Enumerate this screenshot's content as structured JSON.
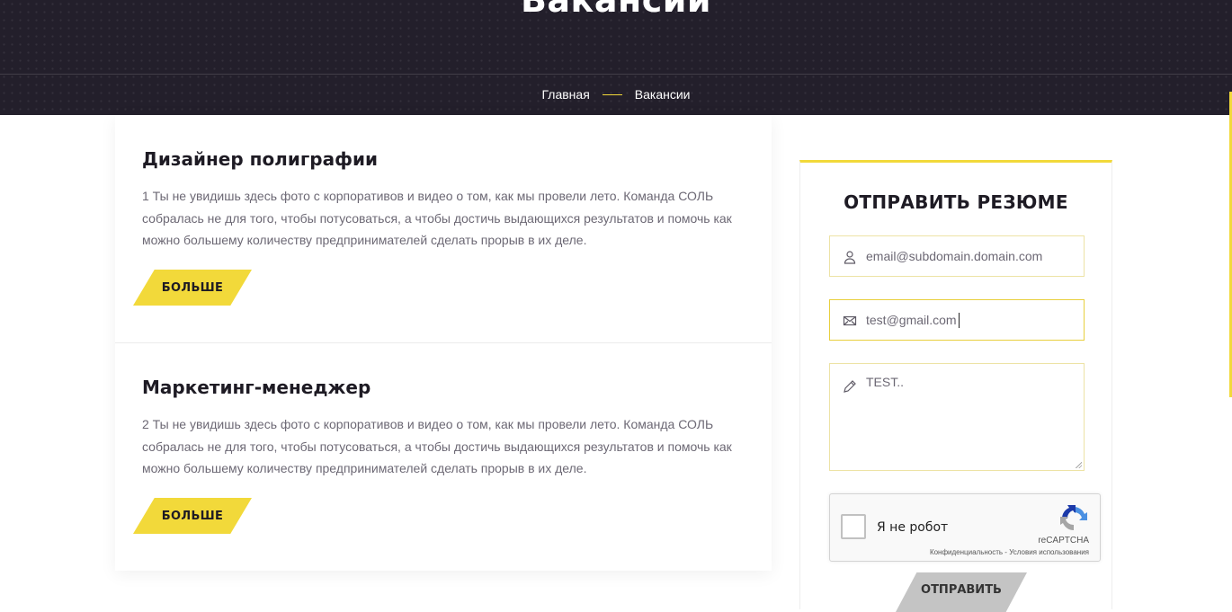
{
  "hero": {
    "title": "Вакансии",
    "breadcrumb": [
      "Главная",
      "Вакансии"
    ]
  },
  "colors": {
    "accent": "#f2d93a",
    "hero_bg": "#231f2b",
    "text_dark": "#1e1b24",
    "text_muted": "#6c6874"
  },
  "vacancies": [
    {
      "title": "Дизайнер полиграфии",
      "description": "1 Ты не увидишь здесь фото с корпоративов и видео о том, как мы провели лето. Команда СОЛЬ собралась не для того, чтобы потусоваться, а чтобы достичь выдающихся результатов и помочь как можно большему количеству предпринимателей сделать прорыв в их деле.",
      "button": "БОЛЬШЕ"
    },
    {
      "title": "Маркетинг-менеджер",
      "description": "2 Ты не увидишь здесь фото с корпоративов и видео о том, как мы провели лето. Команда СОЛЬ собралась не для того, чтобы потусоваться, а чтобы достичь выдающихся результатов и помочь как можно большему количеству предпринимателей сделать прорыв в их деле.",
      "button": "БОЛЬШЕ"
    }
  ],
  "resume_form": {
    "title": "ОТПРАВИТЬ РЕЗЮМЕ",
    "name_field": {
      "value": "email@subdomain.domain.com",
      "icon": "user-icon"
    },
    "email_field": {
      "value": "test@gmail.com",
      "icon": "envelope-icon"
    },
    "message_field": {
      "value": "TEST..",
      "icon": "pencil-icon"
    },
    "captcha": {
      "label": "Я не робот",
      "brand": "reCAPTCHA",
      "terms": "Конфиденциальность - Условия использования"
    },
    "submit": "ОТПРАВИТЬ"
  }
}
